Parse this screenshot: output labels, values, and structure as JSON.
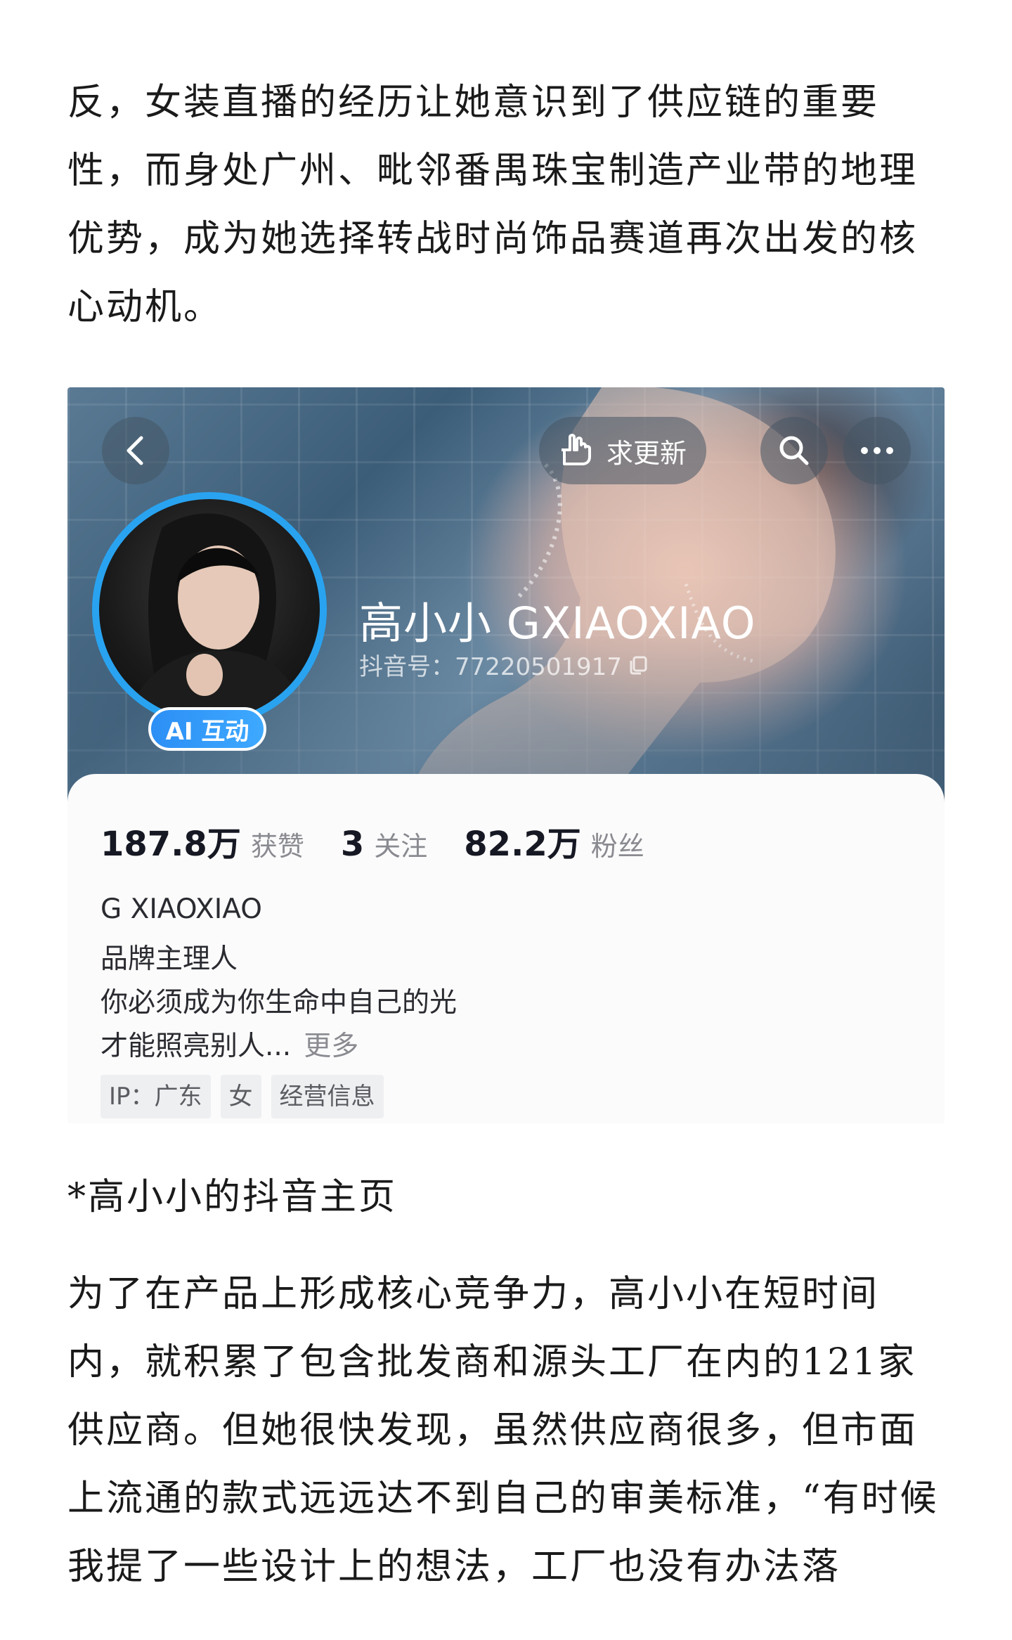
{
  "article": {
    "paragraph1": "反，女装直播的经历让她意识到了供应链的重要性，而身处广州、毗邻番禺珠宝制造产业带的地理优势，成为她选择转战时尚饰品赛道再次出发的核心动机。",
    "caption": "*高小小的抖音主页",
    "paragraph2": "为了在产品上形成核心竞争力，高小小在短时间内，就积累了包含批发商和源头工厂在内的121家供应商。但她很快发现，虽然供应商很多，但市面上流通的款式远远达不到自己的审美标准，“有时候我提了一些设计上的想法，工厂也没有办法落"
  },
  "profile": {
    "update_label": "求更新",
    "ai_badge": "AI 互动",
    "display_name": "高小小 GXIAOXIAO",
    "douyin_id": "抖音号：77220501917",
    "stats": {
      "likes_value": "187.8万",
      "likes_label": "获赞",
      "following_value": "3",
      "following_label": "关注",
      "followers_value": "82.2万",
      "followers_label": "粉丝"
    },
    "bio": {
      "name": "G XIAOXIAO",
      "line1": "品牌主理人",
      "line2": "你必须成为你生命中自己的光",
      "line3": "才能照亮别人...",
      "more": "更多"
    },
    "tags": [
      "IP：广东",
      "女",
      "经营信息"
    ]
  },
  "icons": [
    "chevron-left-icon",
    "hand-icon",
    "search-icon",
    "more-icon",
    "copy-icon"
  ],
  "colors": {
    "avatar_ring": "#29a3f0",
    "ai_badge": "#2c8ff5",
    "text_dark": "#1a1a1a",
    "text_muted": "#8a8b91"
  }
}
